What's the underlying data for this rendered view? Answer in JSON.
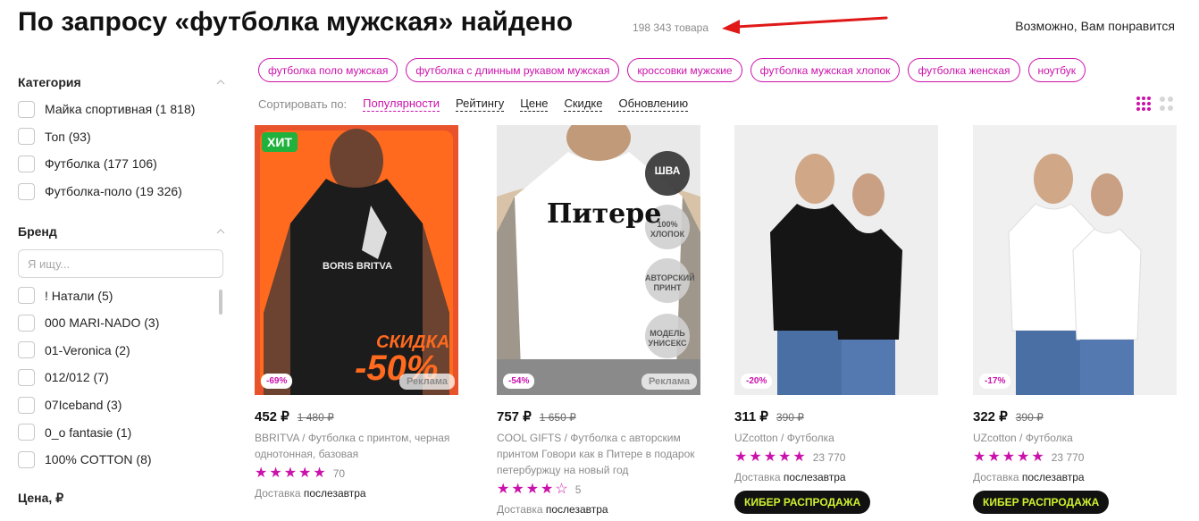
{
  "header": {
    "title": "По запросу «футболка мужская» найдено",
    "count": "198 343 товара",
    "maybe_like": "Возможно, Вам понравится"
  },
  "sidebar": {
    "category": {
      "title": "Категория",
      "items": [
        "Майка спортивная (1 818)",
        "Топ (93)",
        "Футболка (177 106)",
        "Футболка-поло (19 326)"
      ]
    },
    "brand": {
      "title": "Бренд",
      "search_placeholder": "Я ищу...",
      "items": [
        "! Натали (5)",
        "000 MARI-NADO (3)",
        "01-Veronica (2)",
        "012/012 (7)",
        "07Iceband (3)",
        "0_o fantasie (1)",
        "100% COTTON (8)"
      ]
    },
    "price": {
      "title": "Цена, ₽"
    }
  },
  "chips": [
    "футболка поло мужская",
    "футболка с длинным рукавом мужская",
    "кроссовки мужские",
    "футболка мужская хлопок",
    "футболка женская",
    "ноутбук"
  ],
  "sort": {
    "label": "Сортировать по:",
    "options": [
      "Популярности",
      "Рейтингу",
      "Цене",
      "Скидке",
      "Обновлению"
    ],
    "active": "Популярности"
  },
  "products": [
    {
      "price": "452 ₽",
      "old_price": "1 480 ₽",
      "discount": "-69%",
      "ad": "Реклама",
      "hit": "ХИТ",
      "brand": "BBRITVA",
      "name": "Футболка с принтом, черная однотонная, базовая",
      "stars": 5,
      "reviews": "70",
      "delivery_label": "Доставка",
      "delivery_day": "послезавтра",
      "print_brand": "BORIS BRITVA",
      "print_sale": "СКИДКА",
      "print_pct": "-50%",
      "img_bg": "#e8532b",
      "shirt_color": "#1c1c1c"
    },
    {
      "price": "757 ₽",
      "old_price": "1 650 ₽",
      "discount": "-54%",
      "ad": "Реклама",
      "brand": "COOL GIFTS",
      "name": "Футболка с авторским принтом Говори как в Питере в подарок петербуржцу на новый год",
      "stars": 4,
      "reviews": "5",
      "delivery_label": "Доставка",
      "delivery_day": "послезавтра",
      "print_text": "Питере",
      "tags": [
        "ШВА",
        "100% ХЛОПОК",
        "АВТОРСКИЙ ПРИНТ",
        "МОДЕЛЬ УНИСЕКС"
      ],
      "img_bg": "#e9e9e9",
      "shirt_color": "#ffffff"
    },
    {
      "price": "311 ₽",
      "old_price": "390 ₽",
      "discount": "-20%",
      "brand": "UZcotton",
      "name": "Футболка",
      "stars": 5,
      "reviews": "23 770",
      "delivery_label": "Доставка",
      "delivery_day": "послезавтра",
      "promo": "КИБЕР РАСПРОДАЖА",
      "img_bg": "#eeeeee",
      "shirt_color": "#151515"
    },
    {
      "price": "322 ₽",
      "old_price": "390 ₽",
      "discount": "-17%",
      "brand": "UZcotton",
      "name": "Футболка",
      "stars": 5,
      "reviews": "23 770",
      "delivery_label": "Доставка",
      "delivery_day": "послезавтра",
      "promo": "КИБЕР РАСПРОДАЖА",
      "img_bg": "#f0f0f0",
      "shirt_color": "#ffffff"
    }
  ],
  "colors": {
    "accent": "#cb11ab",
    "promo_bg": "#111111",
    "promo_text": "#cdf12f",
    "hit": "#20b23c"
  },
  "icons": [
    "chevron-up-icon",
    "arrow-annotation",
    "grid-view-icon",
    "grid-large-view-icon",
    "star-icon"
  ]
}
